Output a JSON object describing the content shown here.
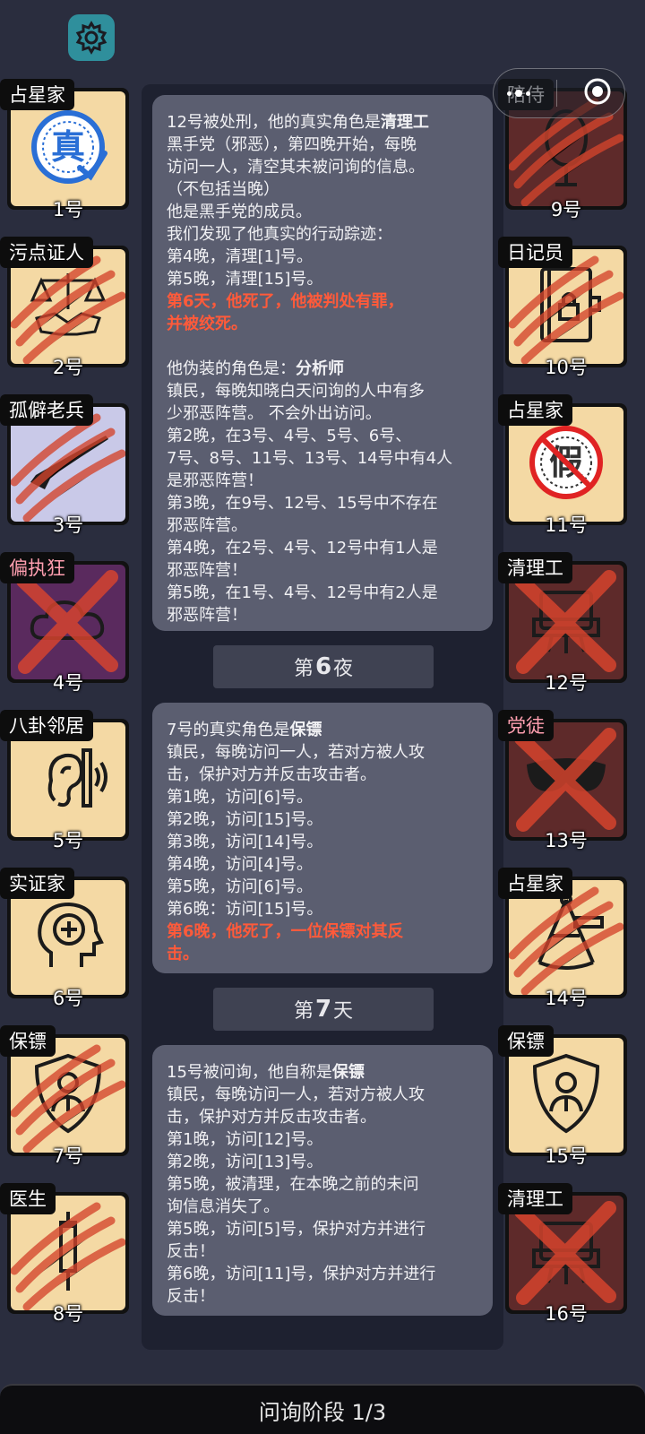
{
  "settings_icon": "gear-icon",
  "capsule": {
    "menu_icon": "more-dots-icon",
    "close_icon": "target-circle-icon"
  },
  "left_players": [
    {
      "role": "占星家",
      "num": "1号",
      "bg": "#f4d9a4",
      "icon": "true-stamp-icon",
      "mark": "none"
    },
    {
      "role": "污点证人",
      "num": "2号",
      "bg": "#f4d9a4",
      "icon": "scales-handshake-icon",
      "mark": "claw"
    },
    {
      "role": "孤僻老兵",
      "num": "3号",
      "bg": "#c9c9e8",
      "icon": "rifle-icon",
      "mark": "claw"
    },
    {
      "role": "偏执狂",
      "num": "4号",
      "bg": "#5a2a5e",
      "icon": "cloud-icon",
      "mark": "cross",
      "role_color": "#ff9fb0"
    },
    {
      "role": "八卦邻居",
      "num": "5号",
      "bg": "#f4d9a4",
      "icon": "ear-icon",
      "mark": "none"
    },
    {
      "role": "实证家",
      "num": "6号",
      "bg": "#f4d9a4",
      "icon": "head-plus-icon",
      "mark": "none"
    },
    {
      "role": "保镖",
      "num": "7号",
      "bg": "#f4d9a4",
      "icon": "shield-person-icon",
      "mark": "claw"
    },
    {
      "role": "医生",
      "num": "8号",
      "bg": "#f4d9a4",
      "icon": "syringe-icon",
      "mark": "claw"
    }
  ],
  "right_players": [
    {
      "role": "陪侍",
      "num": "9号",
      "bg": "#5e2a2a",
      "icon": "mirror-icon",
      "mark": "claw"
    },
    {
      "role": "日记员",
      "num": "10号",
      "bg": "#f4d9a4",
      "icon": "diary-lock-icon",
      "mark": "claw"
    },
    {
      "role": "占星家",
      "num": "11号",
      "bg": "#f4d9a4",
      "icon": "false-stamp-icon",
      "mark": "none"
    },
    {
      "role": "清理工",
      "num": "12号",
      "bg": "#5e2a2a",
      "icon": "cleaner-cart-icon",
      "mark": "cross"
    },
    {
      "role": "党徒",
      "num": "13号",
      "bg": "#5e2a2a",
      "icon": "mask-icon",
      "mark": "cross",
      "role_color": "#ff9fb0"
    },
    {
      "role": "占星家",
      "num": "14号",
      "bg": "#f4d9a4",
      "icon": "sextant-icon",
      "mark": "claw"
    },
    {
      "role": "保镖",
      "num": "15号",
      "bg": "#f4d9a4",
      "icon": "shield-person-icon",
      "mark": "none"
    },
    {
      "role": "清理工",
      "num": "16号",
      "bg": "#5e2a2a",
      "icon": "cleaner-cart-icon",
      "mark": "cross"
    }
  ],
  "log": {
    "card1": [
      {
        "t": "12号被处刑，他的真实角色是",
        "b": "清理工"
      },
      {
        "t": "黑手党（邪恶），第四晚开始，每晚"
      },
      {
        "t": "访问一人，清空其未被问询的信息。"
      },
      {
        "t": "（不包括当晚）"
      },
      {
        "t": "他是黑手党的成员。"
      },
      {
        "t": "我们发现了他真实的行动踪迹："
      },
      {
        "t": "第4晚，清理[1]号。"
      },
      {
        "t": "第5晚，清理[15]号。"
      },
      {
        "t": "第6天，他死了，他被判处有罪，",
        "red": true
      },
      {
        "t": "并被绞死。",
        "red": true
      },
      {
        "t": ""
      },
      {
        "t": "他伪装的角色是：",
        "b": "分析师"
      },
      {
        "t": "镇民，每晚知晓白天问询的人中有多"
      },
      {
        "t": "少邪恶阵营。 不会外出访问。"
      },
      {
        "t": "第2晚，在3号、4号、5号、6号、"
      },
      {
        "t": "7号、8号、11号、13号、14号中有4人"
      },
      {
        "t": "是邪恶阵营！"
      },
      {
        "t": "第3晚，在9号、12号、15号中不存在"
      },
      {
        "t": "邪恶阵营。"
      },
      {
        "t": "第4晚，在2号、4号、12号中有1人是"
      },
      {
        "t": "邪恶阵营！"
      },
      {
        "t": "第5晚，在1号、4号、12号中有2人是"
      },
      {
        "t": "邪恶阵营！"
      }
    ],
    "banner1": {
      "pre": "第",
      "num": "6",
      "post": "夜"
    },
    "card2": [
      {
        "t": "7号的真实角色是",
        "b": "保镖"
      },
      {
        "t": "镇民，每晚访问一人，若对方被人攻"
      },
      {
        "t": "击，保护对方并反击攻击者。"
      },
      {
        "t": "第1晚，访问[6]号。"
      },
      {
        "t": "第2晚，访问[15]号。"
      },
      {
        "t": "第3晚，访问[14]号。"
      },
      {
        "t": "第4晚，访问[4]号。"
      },
      {
        "t": "第5晚，访问[6]号。"
      },
      {
        "t": "第6晚：访问[15]号。"
      },
      {
        "t": "第6晚，他死了，一位保镖对其反",
        "red": true
      },
      {
        "t": "击。",
        "red": true
      }
    ],
    "banner2": {
      "pre": "第",
      "num": "7",
      "post": "天"
    },
    "card3": [
      {
        "t": "15号被问询，他自称是",
        "b": "保镖"
      },
      {
        "t": "镇民，每晚访问一人，若对方被人攻"
      },
      {
        "t": "击，保护对方并反击攻击者。"
      },
      {
        "t": "第1晚，访问[12]号。"
      },
      {
        "t": "第2晚，访问[13]号。"
      },
      {
        "t": "第5晚，被清理，在本晚之前的未问"
      },
      {
        "t": "询信息消失了。"
      },
      {
        "t": "第5晚，访问[5]号，保护对方并进行"
      },
      {
        "t": "反击！"
      },
      {
        "t": "第6晚，访问[11]号，保护对方并进行"
      },
      {
        "t": "反击！"
      }
    ]
  },
  "bottom_bar": "问询阶段 1/3",
  "colors": {
    "background": "#2a2d3e",
    "bubble": "#5b5e70",
    "highlight_red": "#ff5a3a",
    "gear_bg": "#2f8f9c"
  }
}
